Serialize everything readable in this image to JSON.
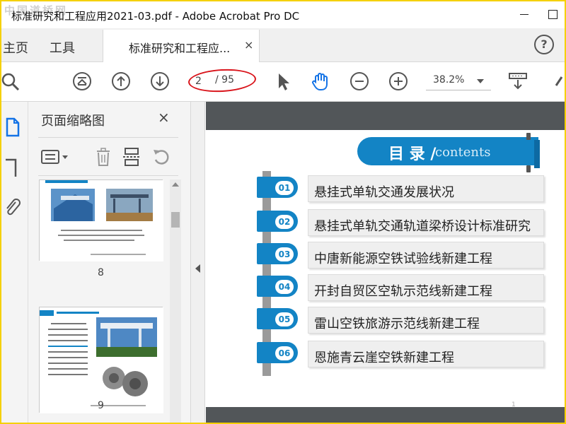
{
  "window": {
    "title": "标准研究和工程应用2021-03.pdf - Adobe Acrobat Pro DC",
    "watermark": "中国道桥网"
  },
  "tabs": {
    "home": "主页",
    "tools": "工具",
    "document": "标准研究和工程应...",
    "close_glyph": "×",
    "help_glyph": "?"
  },
  "toolbar": {
    "current_page": "2",
    "total_pages": "/ 95",
    "zoom": "38.2%",
    "highlight_color": "#d9141b"
  },
  "thumbnail_panel": {
    "title": "页面缩略图",
    "close_glyph": "×",
    "pages": [
      {
        "number": "8"
      },
      {
        "number": "9"
      }
    ]
  },
  "document": {
    "toc_title_cn": "目 录 /",
    "toc_title_en": "contents",
    "accent_color": "#1384c5",
    "page_number": "1",
    "items": [
      {
        "num": "01",
        "text": "悬挂式单轨交通发展状况"
      },
      {
        "num": "02",
        "text": "悬挂式单轨交通轨道梁桥设计标准研究"
      },
      {
        "num": "03",
        "text": "中唐新能源空铁试验线新建工程"
      },
      {
        "num": "04",
        "text": "开封自贸区空轨示范线新建工程"
      },
      {
        "num": "05",
        "text": "雷山空铁旅游示范线新建工程"
      },
      {
        "num": "06",
        "text": "恩施青云崖空铁新建工程"
      }
    ]
  }
}
